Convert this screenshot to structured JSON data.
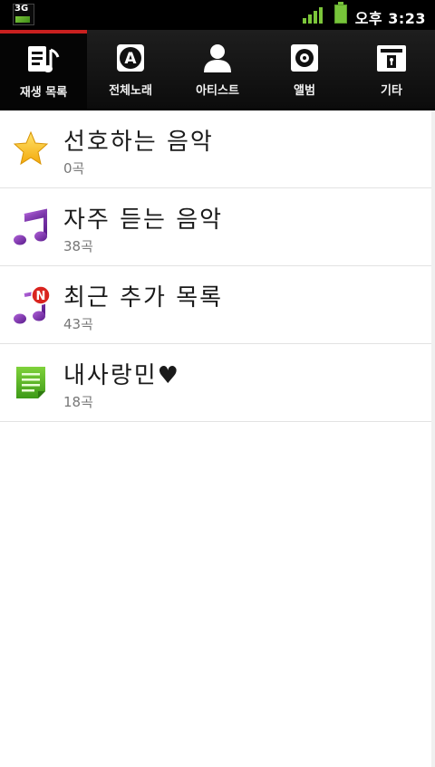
{
  "status_bar": {
    "network_label": "3G",
    "clock": "오후 3:23",
    "colors": {
      "signal": "#7cc63a",
      "battery": "#77c43a"
    }
  },
  "tabs": [
    {
      "label": "재생 목록",
      "icon": "playlist-icon",
      "active": true
    },
    {
      "label": "전체노래",
      "icon": "all-songs-icon",
      "active": false
    },
    {
      "label": "아티스트",
      "icon": "artist-icon",
      "active": false
    },
    {
      "label": "앨범",
      "icon": "album-icon",
      "active": false
    },
    {
      "label": "기타",
      "icon": "other-icon",
      "active": false
    }
  ],
  "playlists": [
    {
      "title": "선호하는 음악",
      "count": "0곡",
      "icon": "star-icon"
    },
    {
      "title": "자주 듣는 음악",
      "count": "38곡",
      "icon": "music-note-icon"
    },
    {
      "title": "최근 추가 목록",
      "count": "43곡",
      "icon": "music-note-new-icon",
      "badge": "N"
    },
    {
      "title": "내사랑민♥",
      "count": "18곡",
      "icon": "document-list-icon"
    }
  ],
  "accent_color": "#c9201f"
}
